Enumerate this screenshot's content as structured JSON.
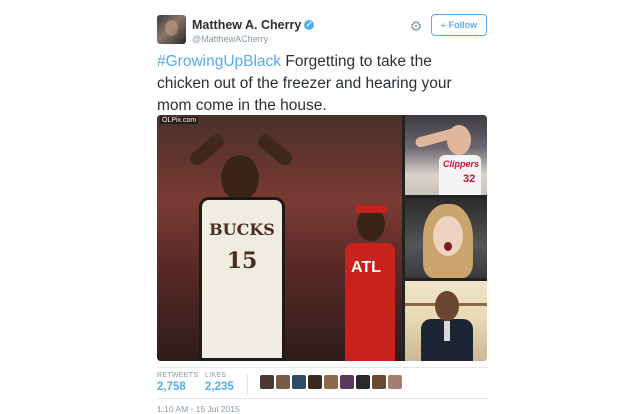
{
  "author": {
    "name": "Matthew A. Cherry",
    "handle": "@MatthewACherry",
    "verified_glyph": "✓"
  },
  "actions": {
    "settings_icon": "gear-icon",
    "follow_label": "Follow",
    "follow_glyph": "+"
  },
  "tweet": {
    "hashtag": "#GrowingUpBlack",
    "body": " Forgetting to take the chicken out of the freezer and hearing your mom come in the house."
  },
  "media": {
    "watermark": "OLPix.com",
    "main_jersey_team": "BUCKS",
    "main_jersey_number": "15",
    "bg_jersey_text": "ATL",
    "small1_jersey_team": "Clippers",
    "small1_jersey_number": "32"
  },
  "stats": {
    "retweets_label": "RETWEETS",
    "retweets_value": "2,758",
    "likes_label": "LIKES",
    "likes_value": "2,235",
    "liker_colors": [
      "#4a3a33",
      "#7a5a48",
      "#2f4a6a",
      "#3a2a22",
      "#8a6a4a",
      "#5a3a5a",
      "#2a2a2a",
      "#6a4a30",
      "#a08070"
    ]
  },
  "timestamp": "1:10 AM - 15 Jul 2015",
  "colors": {
    "accent": "#55acee",
    "text": "#292f33",
    "muted": "#8899a6"
  }
}
